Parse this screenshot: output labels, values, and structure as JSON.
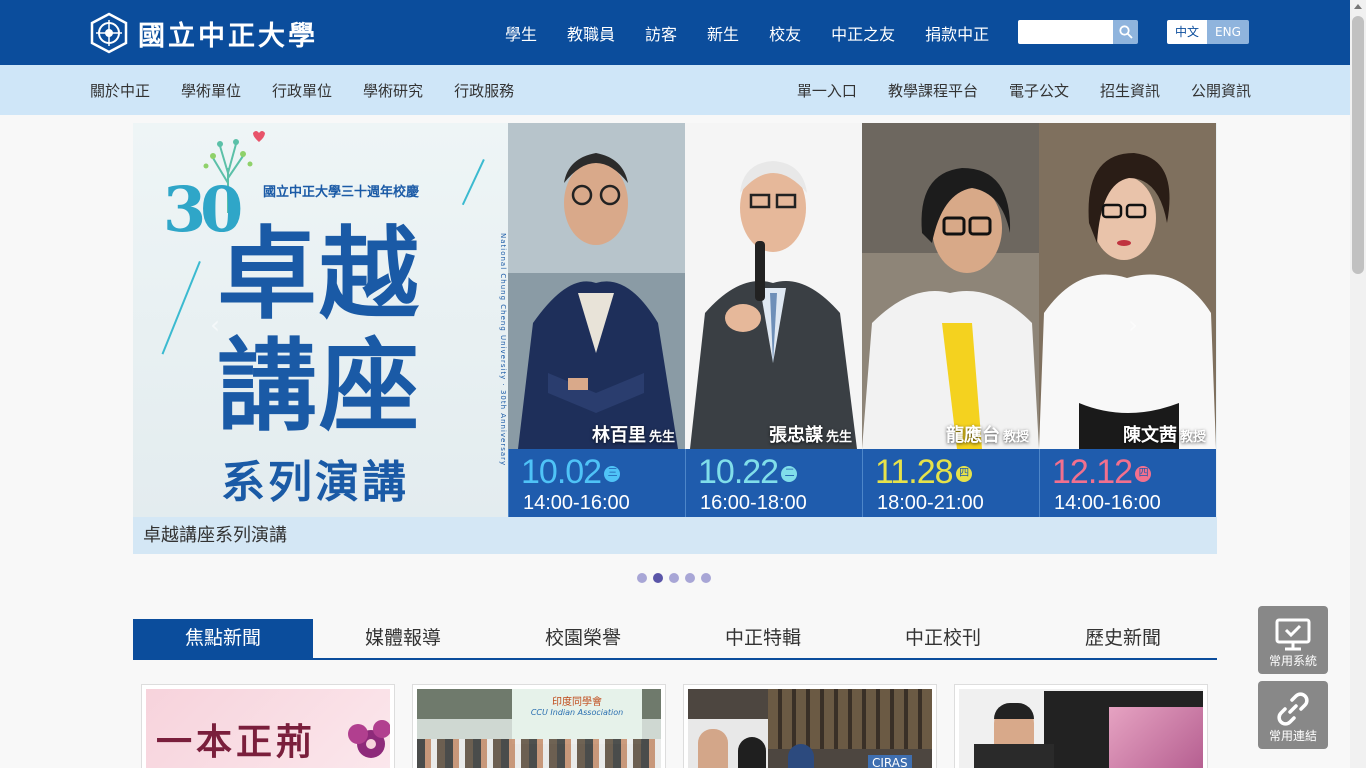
{
  "header": {
    "logo_text": "國立中正大學",
    "nav": [
      "學生",
      "教職員",
      "訪客",
      "新生",
      "校友",
      "中正之友",
      "捐款中正"
    ],
    "search": {
      "value": "",
      "placeholder": ""
    },
    "lang": {
      "zh": "中文",
      "en": "ENG"
    }
  },
  "subnav": {
    "left": [
      "關於中正",
      "學術單位",
      "行政單位",
      "學術研究",
      "行政服務"
    ],
    "right": [
      "單一入口",
      "教學課程平台",
      "電子公文",
      "招生資訊",
      "公開資訊"
    ]
  },
  "banner": {
    "anniv_number": "30",
    "anniv_title": "國立中正大學三十週年校慶",
    "title_line1": "卓越",
    "title_line2": "講座",
    "subtitle": "系列演講",
    "vertical_text": "National Chung Cheng University · 30th Anniversary",
    "speakers": [
      {
        "name": "林百里",
        "title": "先生",
        "date": "10.02",
        "dow": "三",
        "time": "14:00-16:00",
        "date_color": "#4fc3f7",
        "dow_bg": "#4fc3f7"
      },
      {
        "name": "張忠謀",
        "title": "先生",
        "date": "10.22",
        "dow": "二",
        "time": "16:00-18:00",
        "date_color": "#80deea",
        "dow_bg": "#80deea"
      },
      {
        "name": "龍應台",
        "title": "教授",
        "date": "11.28",
        "dow": "四",
        "time": "18:00-21:00",
        "date_color": "#e6e24a",
        "dow_bg": "#e6e24a"
      },
      {
        "name": "陳文茜",
        "title": "教授",
        "date": "12.12",
        "dow": "四",
        "time": "14:00-16:00",
        "date_color": "#f2708e",
        "dow_bg": "#f2708e"
      }
    ],
    "caption": "卓越講座系列演講",
    "carousel": {
      "total": 5,
      "active": 2
    }
  },
  "news_tabs": [
    "焦點新聞",
    "媒體報導",
    "校園榮譽",
    "中正特輯",
    "中正校刊",
    "歷史新聞"
  ],
  "cards": [
    {
      "text": "一本正荊"
    },
    {
      "text": "印度同學會",
      "subtext": "CCU Indian Association"
    },
    {
      "text": "CIRAS"
    },
    {
      "text": ""
    }
  ],
  "float_buttons": [
    {
      "label": "常用系統",
      "icon": "monitor-check-icon"
    },
    {
      "label": "常用連結",
      "icon": "link-icon"
    }
  ]
}
